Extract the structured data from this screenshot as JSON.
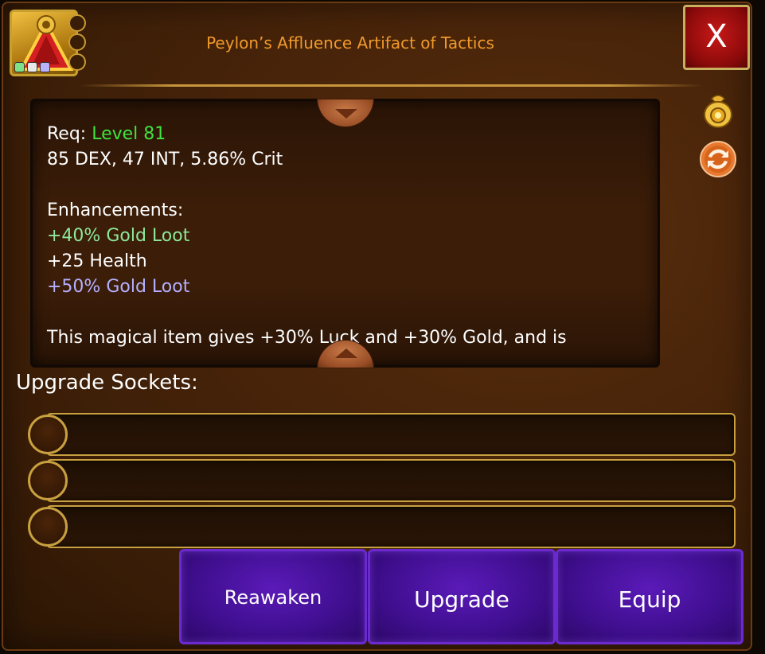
{
  "item": {
    "title": "Peylon’s Affluence Artifact of Tactics",
    "icon": "artifact-amulet-icon",
    "rarity_colors": [
      "#7ee08a",
      "#e8e8e8",
      "#b8b2ff"
    ]
  },
  "close_label": "X",
  "description": {
    "req_label": "Req:",
    "req_value": "Level 81",
    "stats": "85 DEX, 47 INT, 5.86% Crit",
    "enhancements_label": "Enhancements:",
    "enhancements": [
      {
        "text": "+40% Gold Loot",
        "color": "#8de89a"
      },
      {
        "text": "+25 Health",
        "color": "#ffffff"
      },
      {
        "text": "+50% Gold Loot",
        "color": "#b4b0ff"
      }
    ],
    "flavor": "This magical item gives +30% Luck and +30% Gold, and is"
  },
  "side_icons": [
    "gold-bag-icon",
    "swap-icon"
  ],
  "sockets": {
    "label": "Upgrade Sockets:",
    "slots": [
      "empty",
      "empty",
      "empty"
    ]
  },
  "buttons": {
    "reawaken": "Reawaken",
    "upgrade": "Upgrade",
    "equip": "Equip"
  },
  "colors": {
    "title": "#f09a2a",
    "level": "#3ee43e",
    "button_purple": "#4a12a0",
    "close_red": "#b01010",
    "gold_border": "#c8a040"
  }
}
